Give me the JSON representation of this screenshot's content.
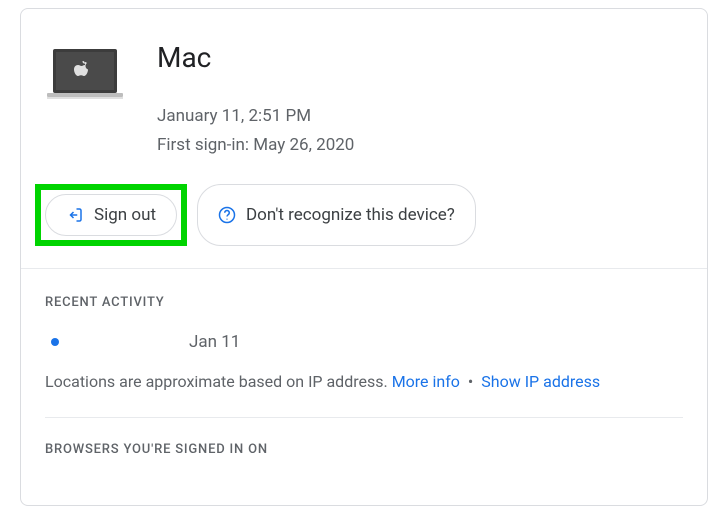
{
  "device": {
    "name": "Mac",
    "last_activity": "January 11, 2:51 PM",
    "first_signin_label": "First sign-in: May 26, 2020"
  },
  "actions": {
    "sign_out": "Sign out",
    "dont_recognize": "Don't recognize this device?"
  },
  "recent_activity": {
    "label": "Recent Activity",
    "item_date": "Jan 11",
    "disclaimer": "Locations are approximate based on IP address. ",
    "more_info": "More info",
    "show_ip": "Show IP address"
  },
  "browsers_label": "Browsers you're signed in on"
}
